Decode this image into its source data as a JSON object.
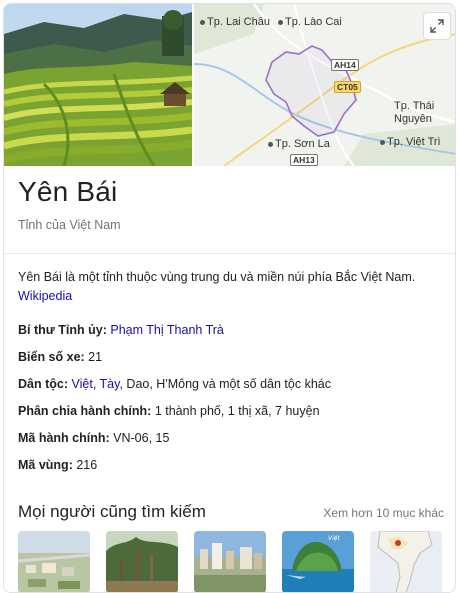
{
  "entity": {
    "title": "Yên Bái",
    "subtitle": "Tỉnh của Việt Nam",
    "description": "Yên Bái là một tỉnh thuộc vùng trung du và miền núi phía Bắc Việt Nam.",
    "source_link": "Wikipedia"
  },
  "map": {
    "labels": {
      "lai_chau": "Tp. Lai Châu",
      "lao_cai": "Tp. Lào Cai",
      "thai_nguyen_1": "Tp. Thái",
      "thai_nguyen_2": "Nguyên",
      "son_la": "Tp. Sơn La",
      "viet_tri": "Tp. Việt Trì"
    },
    "roads": {
      "ah14": "AH14",
      "ct05": "CT05",
      "ah13": "AH13"
    },
    "boundary_color": "#9b6fc7"
  },
  "facts": [
    {
      "label": "Bí thư Tỉnh ủy:",
      "value": "Phạm Thị Thanh Trà"
    },
    {
      "label": "Biển số xe:",
      "value": "21"
    },
    {
      "label": "Dân tộc:",
      "link1": "Việt",
      "sep1": ", ",
      "link2": "Tày",
      "rest": ", Dao, H'Mông và một số dân tộc khác"
    },
    {
      "label": "Phân chia hành chính:",
      "value": "1 thành phố, 1 thị xã, 7 huyện"
    },
    {
      "label": "Mã hành chính:",
      "value": "VN-06, 15"
    },
    {
      "label": "Mã vùng:",
      "value": "216"
    }
  ],
  "people_also_search": {
    "title": "Mọi người cũng tìm kiếm",
    "more": "Xem hơn 10 mục khác"
  },
  "colors": {
    "link": "#1a0dab",
    "muted": "#70757a"
  },
  "icons": {
    "expand": "expand-icon"
  }
}
